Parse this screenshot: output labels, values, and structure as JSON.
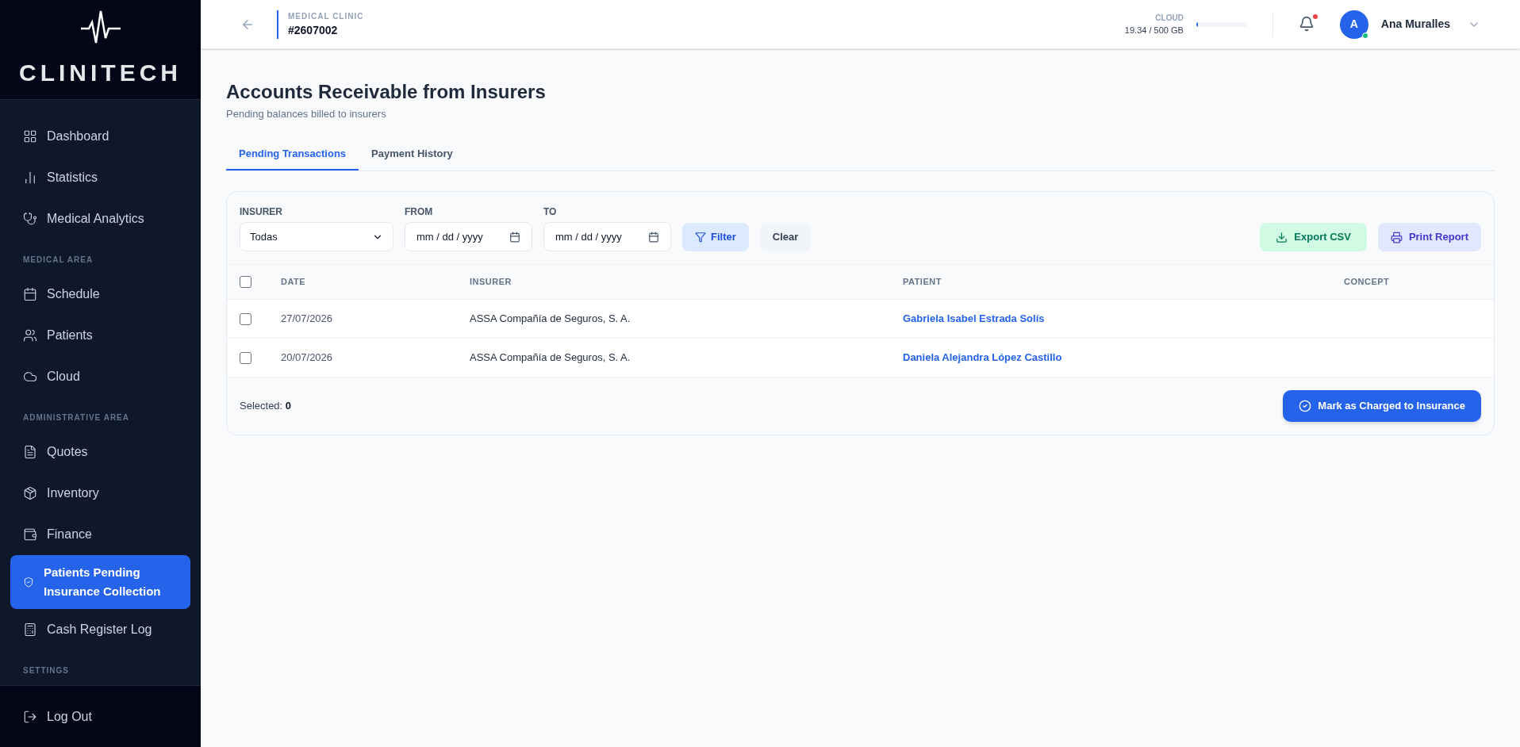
{
  "logo": {
    "text": "CLINITECH"
  },
  "sidebar": {
    "items": [
      {
        "kind": "item",
        "label": "Dashboard",
        "selected": false
      },
      {
        "kind": "item",
        "label": "Statistics",
        "selected": false
      },
      {
        "kind": "item",
        "label": "Medical Analytics",
        "selected": false
      },
      {
        "kind": "section",
        "label": "MEDICAL AREA"
      },
      {
        "kind": "item",
        "label": "Schedule",
        "selected": false
      },
      {
        "kind": "item",
        "label": "Patients",
        "selected": false
      },
      {
        "kind": "item",
        "label": "Cloud",
        "selected": false
      },
      {
        "kind": "section",
        "label": "ADMINISTRATIVE AREA"
      },
      {
        "kind": "item",
        "label": "Quotes",
        "selected": false
      },
      {
        "kind": "item",
        "label": "Inventory",
        "selected": false
      },
      {
        "kind": "item",
        "label": "Finance",
        "selected": false
      },
      {
        "kind": "item",
        "label": "Patients Pending Insurance Collection",
        "selected": true
      },
      {
        "kind": "item",
        "label": "Cash Register Log",
        "selected": false
      },
      {
        "kind": "section",
        "label": "SETTINGS"
      }
    ],
    "logout": "Log Out"
  },
  "header": {
    "clinic_label": "MEDICAL CLINIC",
    "clinic_id": "#2607002",
    "storage_label": "CLOUD",
    "storage_reading": "19.34 / 500 GB",
    "storage": {
      "level": 0.04
    },
    "notifications": true,
    "avatar_initial": "A",
    "online": true,
    "user_name": "Ana Muralles"
  },
  "page": {
    "title": "Accounts Receivable from Insurers",
    "subtitle": "Pending balances billed to insurers"
  },
  "tabs": [
    {
      "label": "Pending Transactions",
      "selected": true
    },
    {
      "label": "Payment History",
      "selected": false
    }
  ],
  "filters": {
    "insurer_label": "INSURER",
    "insurer_value": "Todas",
    "from_label": "FROM",
    "from_placeholder": "mm / dd / yyyy",
    "to_label": "TO",
    "to_placeholder": "mm / dd / yyyy",
    "filter_button": "Filter",
    "clear_button": "Clear",
    "export_button": "Export CSV",
    "print_button": "Print Report"
  },
  "table": {
    "select_all_checked": false,
    "columns": [
      "DATE",
      "INSURER",
      "PATIENT",
      "CONCEPT"
    ],
    "rows": [
      {
        "checked": false,
        "date": "27/07/2026",
        "insurer": "ASSA Compañía de Seguros, S. A.",
        "patient": "Gabriela Isabel Estrada Solís"
      },
      {
        "checked": false,
        "date": "20/07/2026",
        "insurer": "ASSA Compañía de Seguros, S. A.",
        "patient": "Daniela Alejandra López Castillo"
      }
    ]
  },
  "footer": {
    "selected_label": "Selected:",
    "selected_count": "0",
    "action_button": "Mark as Charged to Insurance"
  }
}
